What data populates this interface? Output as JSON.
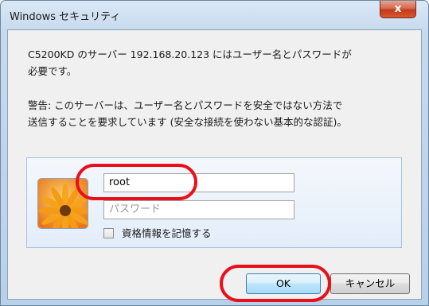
{
  "window": {
    "title": "Windows セキュリティ",
    "close_label": "x"
  },
  "message": {
    "line1": "C5200KD のサーバー 192.168.20.123 にはユーザー名とパスワードが",
    "line2": "必要です。",
    "warning_line1": "警告: このサーバーは、ユーザー名とパスワードを安全ではない方法で",
    "warning_line2": "送信することを要求しています (安全な接続を使わない基本的な認証)。"
  },
  "credentials": {
    "username_value": "root",
    "password_placeholder": "パスワード",
    "remember_label": "資格情報を記憶する"
  },
  "buttons": {
    "ok": "OK",
    "cancel": "キャンセル"
  },
  "colors": {
    "highlight": "#e8101a",
    "accent": "#3c7fb1"
  },
  "icons": {
    "avatar": "flower-user-tile",
    "close": "close-icon"
  }
}
